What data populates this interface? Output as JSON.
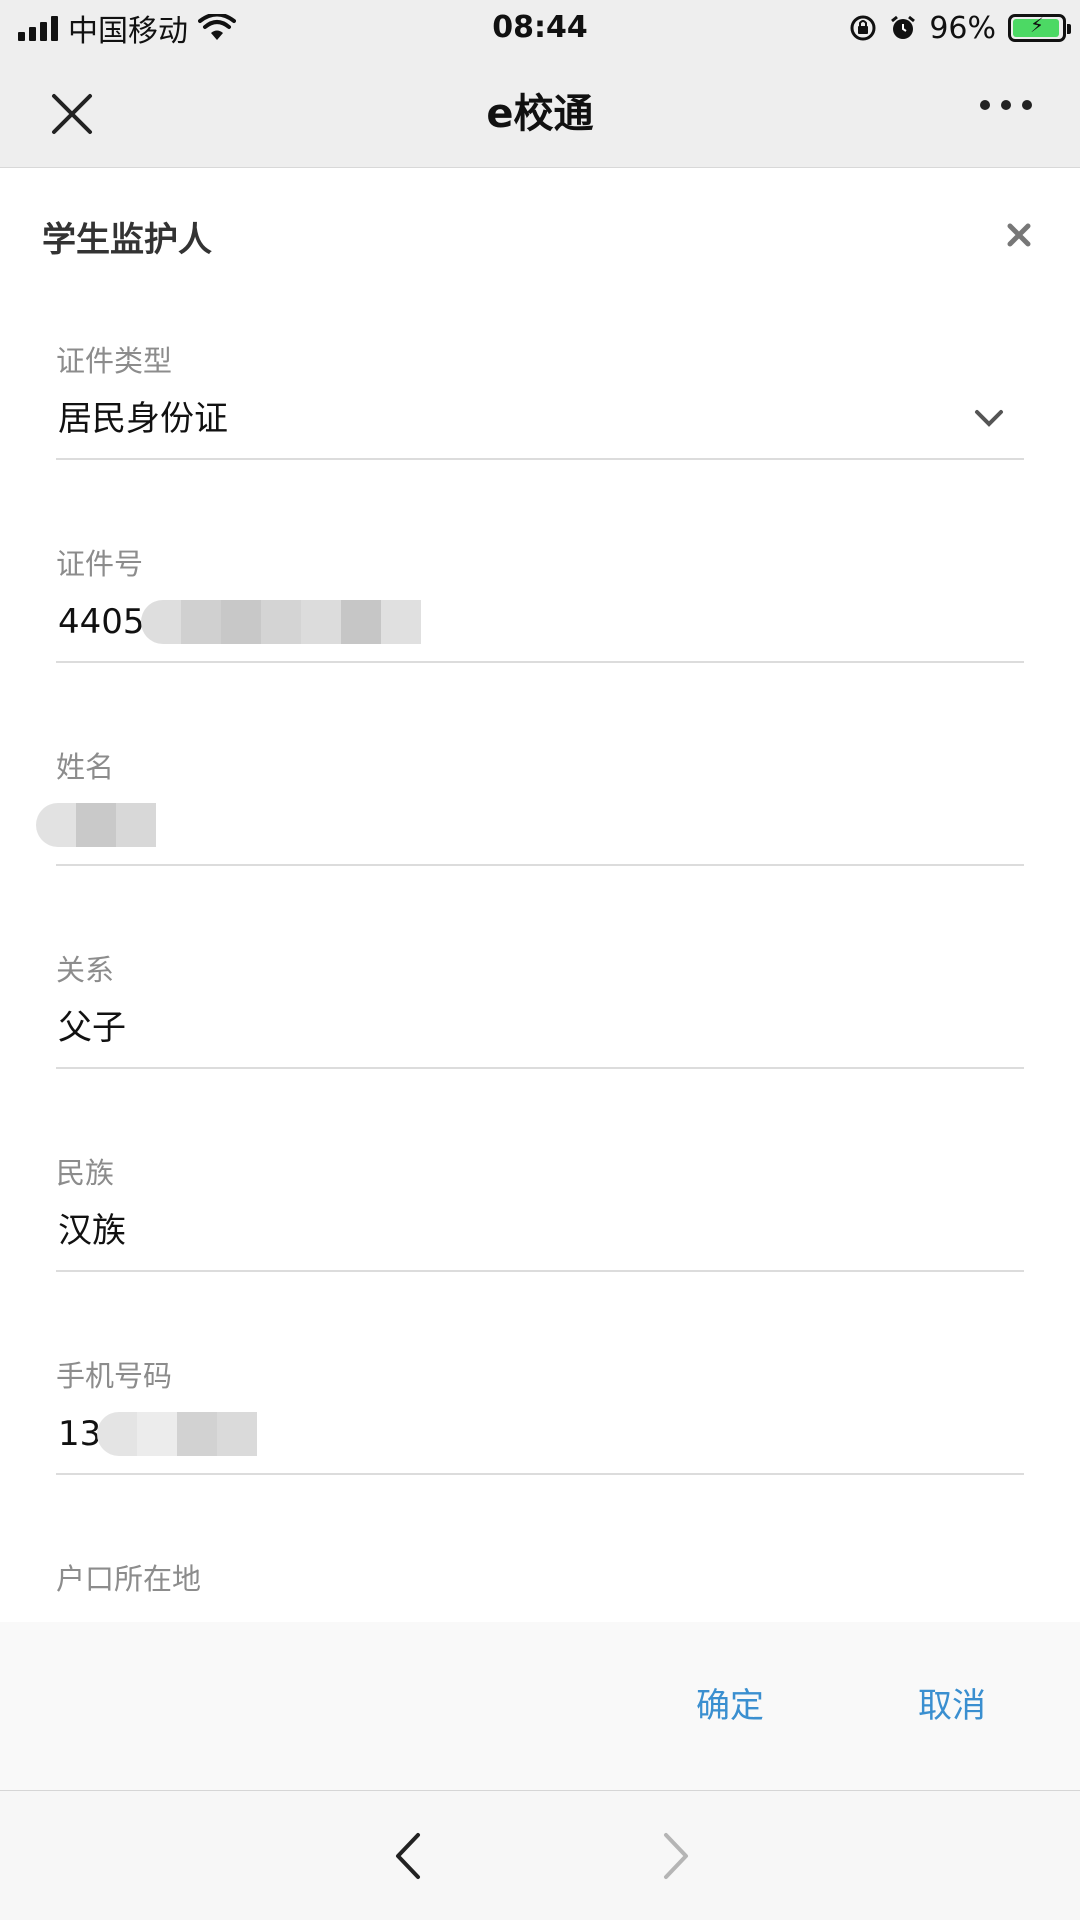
{
  "status_bar": {
    "carrier": "中国移动",
    "time": "08:44",
    "battery": "96%",
    "battery_level": 0.96,
    "icons": [
      "signal-icon",
      "wifi-icon",
      "orientation-lock-icon",
      "alarm-icon",
      "battery-charging-icon"
    ]
  },
  "nav": {
    "title": "e校通"
  },
  "dialog": {
    "title": "学生监护人",
    "fields": [
      {
        "label": "证件类型",
        "value": "居民身份证"
      },
      {
        "label": "证件号",
        "value": "4405"
      },
      {
        "label": "姓名",
        "value": ""
      },
      {
        "label": "关系",
        "value": "父子"
      },
      {
        "label": "民族",
        "value": "汉族"
      },
      {
        "label": "手机号码",
        "value": "13"
      },
      {
        "label": "户口所在地",
        "value": ""
      }
    ],
    "confirm_label": "确定",
    "cancel_label": "取消"
  },
  "colors": {
    "accent": "#3a8fd0",
    "label": "#8c8c8c",
    "battery": "#4cd964"
  }
}
